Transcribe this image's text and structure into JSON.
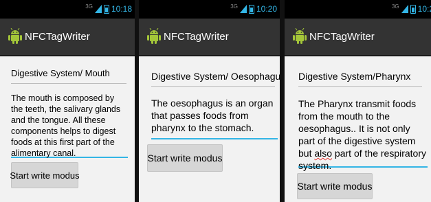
{
  "status": {
    "network": "3G",
    "times": [
      "10:18",
      "10:20",
      "10:2"
    ]
  },
  "app": {
    "title": "NFCTagWriter"
  },
  "screens": [
    {
      "title_value": "Digestive System/ Mouth",
      "body_value": "The mouth is composed by the teeth, the salivary glands and the tongue. All these components helps to digest foods at this first part of the alimentary canal.",
      "button_label": "Start write modus"
    },
    {
      "title_value": "Digestive System/ Oesophagus",
      "body_value": "The oesophagus is an organ that passes foods from pharynx to the stomach.",
      "button_label": "Start write modus"
    },
    {
      "title_value": "Digestive System/Pharynx",
      "body_pre": "The Pharynx  transmit foods from the mouth to the oesophagus.. It is not only part of the digestive system but ",
      "body_misspelled": "also",
      "body_post": " part of the respiratory system.",
      "button_label": "Start write modus"
    }
  ],
  "colors": {
    "accent": "#33b5e5",
    "action_bar": "#333333",
    "background": "#f2f2f2",
    "button": "#d6d6d6"
  }
}
